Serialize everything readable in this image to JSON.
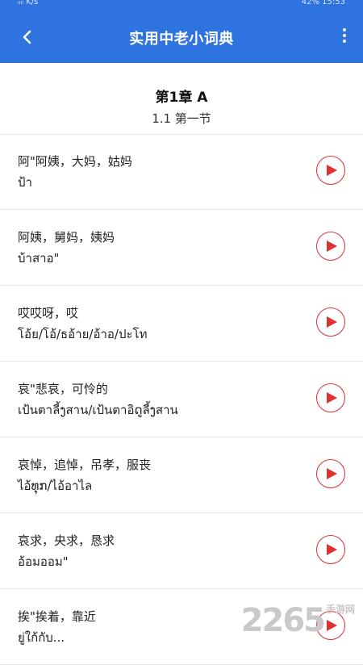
{
  "status_bar": {
    "left": "ᵢᵢₗₗ K/s",
    "right": "42%  15:53"
  },
  "app_bar": {
    "title": "实用中老小词典"
  },
  "chapter": {
    "title": "第1章  A",
    "section": "1.1    第一节"
  },
  "entries": [
    {
      "zh": "阿\"阿姨，大妈，姑妈",
      "lo": "ป้า"
    },
    {
      "zh": "阿姨，舅妈，姨妈",
      "lo": "บ้าสาอ\""
    },
    {
      "zh": "哎哎呀，哎",
      "lo": "โอ้ย/โอ้/ธอ้าย/อ้าอ/ปะโท"
    },
    {
      "zh": "哀\"悲哀，可怜的",
      "lo": "เป้นตาลี้ງสาน/เป้นตาอิດูลี้ງสาน"
    },
    {
      "zh": "哀悼，追悼，吊孝，服丧",
      "lo": "ไอ้ທຸກ/ไอ้อาไล"
    },
    {
      "zh": "哀求，央求，恳求",
      "lo": "อ้อมออม\""
    },
    {
      "zh": "挨\"挨着，靠近",
      "lo": "ยู่ใก้กับ..."
    }
  ],
  "watermark": {
    "text": "2265",
    "suffix": "手游网"
  },
  "colors": {
    "accent": "#2f73e0",
    "play": "#e03030"
  }
}
